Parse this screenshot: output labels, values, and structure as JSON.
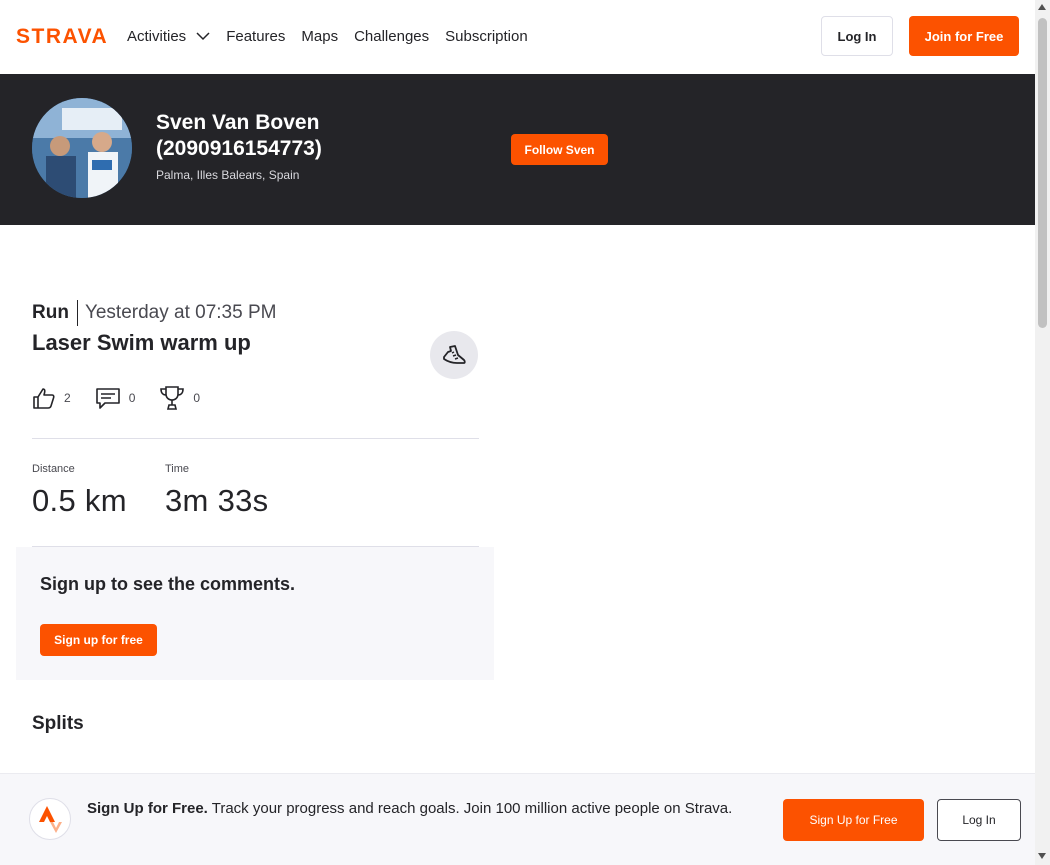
{
  "nav": {
    "brand": "STRAVA",
    "items": [
      {
        "label": "Activities",
        "has_dropdown": true
      },
      {
        "label": "Features"
      },
      {
        "label": "Maps"
      },
      {
        "label": "Challenges"
      },
      {
        "label": "Subscription"
      }
    ],
    "login_label": "Log In",
    "join_label": "Join for Free"
  },
  "athlete": {
    "name": "Sven Van Boven (2090916154773)",
    "location": "Palma, Illes Balears, Spain",
    "follow_label": "Follow Sven"
  },
  "activity": {
    "sport": "Run",
    "when": "Yesterday at 07:35 PM",
    "title": "Laser Swim warm up",
    "kudos": "2",
    "comments": "0",
    "achievements": "0",
    "stats": [
      {
        "label": "Distance",
        "value": "0.5 km"
      },
      {
        "label": "Time",
        "value": "3m 33s"
      }
    ]
  },
  "comments_prompt": {
    "title": "Sign up to see the comments.",
    "button": "Sign up for free"
  },
  "splits": {
    "title": "Splits"
  },
  "banner": {
    "bold": "Sign Up for Free.",
    "text": " Track your progress and reach goals. Join 100 million active people on Strava.",
    "signup_label": "Sign Up for Free",
    "login_label": "Log In"
  },
  "colors": {
    "brand": "#fc5200",
    "header_bg": "#242428"
  }
}
